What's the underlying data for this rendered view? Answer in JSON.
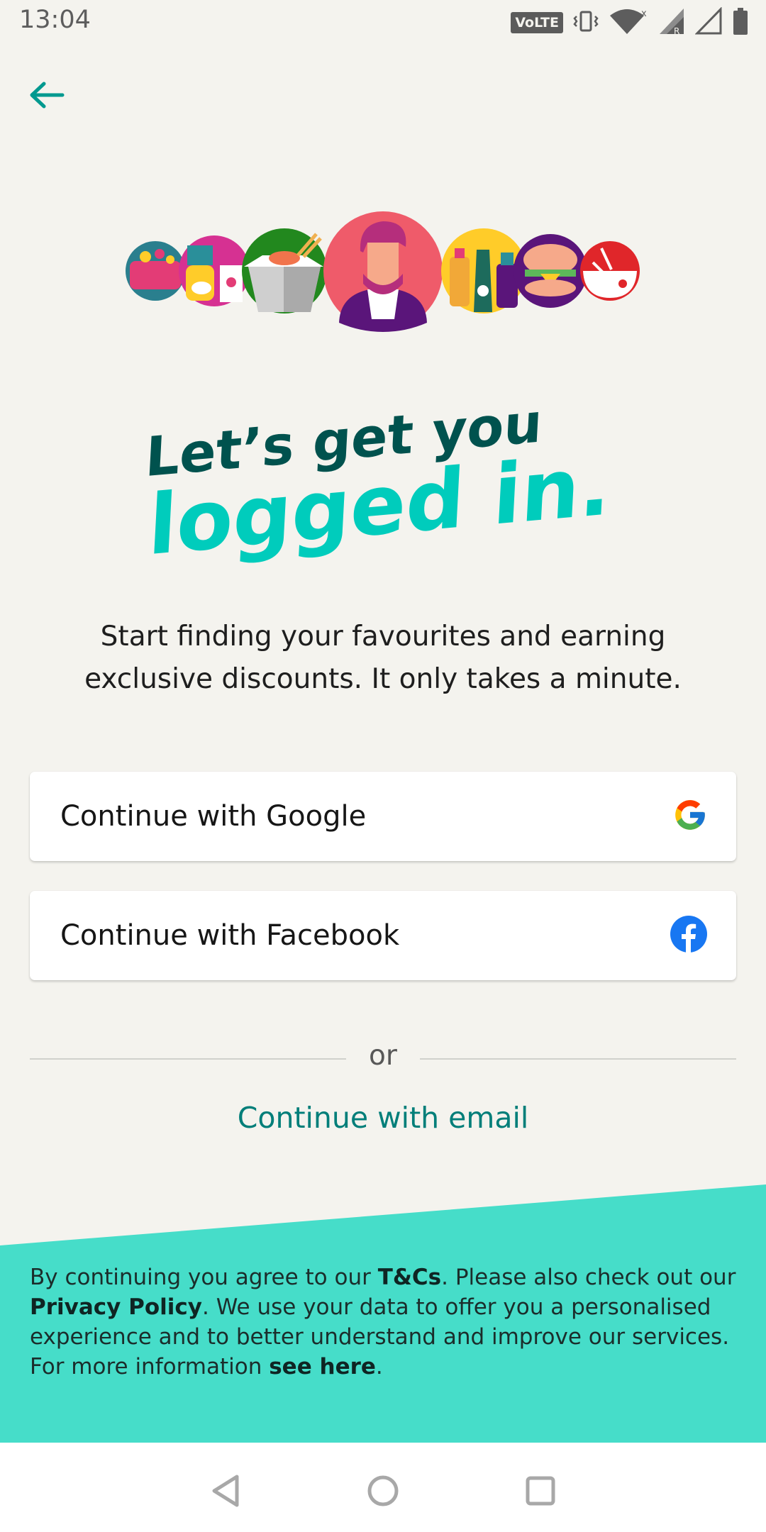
{
  "status_bar": {
    "time": "13:04",
    "volte": "VoLTE",
    "icons": [
      "vibrate-icon",
      "wifi-icon",
      "signal-icon",
      "signal-empty-icon",
      "battery-icon"
    ]
  },
  "header": {
    "back_icon": "arrow-left-icon"
  },
  "hero": {
    "headline_line1": "Let’s get you",
    "headline_line2": "logged in.",
    "subtitle_line1": "Start finding your favourites and earning",
    "subtitle_line2": "exclusive discounts. It only takes a minute."
  },
  "auth": {
    "google_label": "Continue with Google",
    "facebook_label": "Continue with Facebook",
    "or_text": "or",
    "email_label": "Continue with email"
  },
  "legal": {
    "part1": "By continuing you agree to our ",
    "tcs": "T&Cs",
    "part2": ". Please also check out our ",
    "privacy": "Privacy Policy",
    "part3": ". We use your data to offer you a personalised experience and to better understand and improve our services. For more information ",
    "see_here": "see here",
    "part4": "."
  },
  "nav": {
    "icons": [
      "back-triangle-icon",
      "home-circle-icon",
      "recents-square-icon"
    ]
  },
  "colors": {
    "background": "#f4f3ee",
    "teal": "#00ccbc",
    "dark_teal": "#00524e",
    "link": "#007e79",
    "footer": "#46ddc9"
  }
}
